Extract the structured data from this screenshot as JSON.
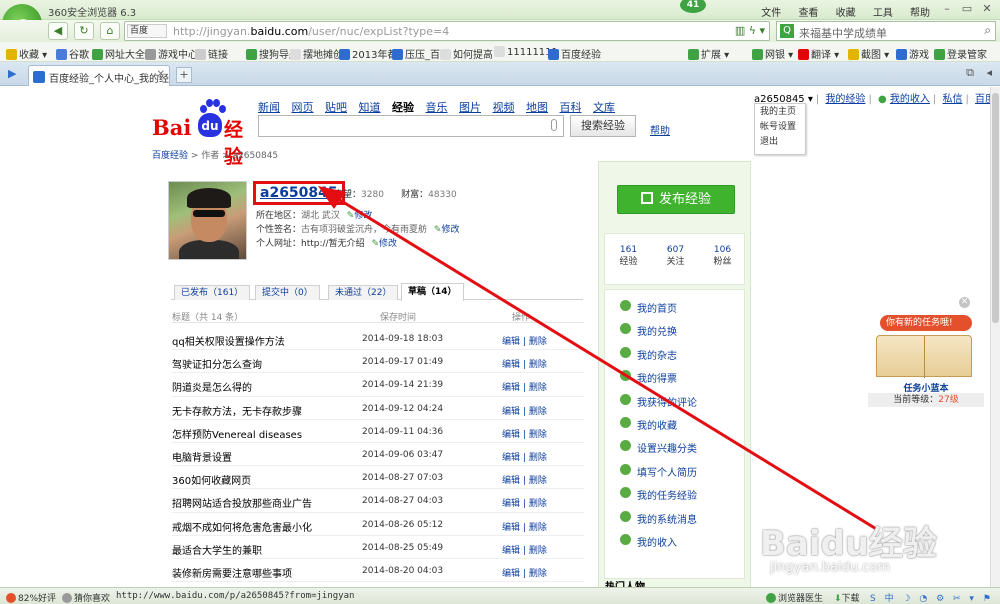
{
  "browser": {
    "title": "360安全浏览器 6.3",
    "menus": [
      "文件",
      "查看",
      "收藏",
      "工具",
      "帮助"
    ],
    "badge": "41",
    "address_prefix": "百度",
    "url_pre": "http://jingyan.",
    "url_host": "baidu.com",
    "url_path": "/user/nuc/expList?type=4",
    "search_placeholder": "来福基中学成绩单",
    "favorites": [
      "收藏",
      "谷歌",
      "网址大全",
      "游戏中心",
      "链接",
      "搜狗导航",
      "摆地摊创",
      "2013年都",
      "压压_百",
      "如何提高",
      "11111111",
      "百度经验"
    ],
    "fav_right": [
      "扩展",
      "网银",
      "翻译",
      "截图",
      "游戏",
      "登录管家"
    ],
    "tab_title": "百度经验_个人中心_我的经验",
    "new_tab": "+"
  },
  "site": {
    "logo": {
      "bai": "Bai",
      "du": "du",
      "jy": "经验"
    },
    "channels": [
      "新闻",
      "网页",
      "贴吧",
      "知道",
      "经验",
      "音乐",
      "图片",
      "视频",
      "地图",
      "百科",
      "文库"
    ],
    "search_button": "搜索经验",
    "help": "帮助",
    "top_user": "a2650845",
    "top_links": [
      "我的经验",
      "我的收入",
      "私信",
      "百度首页"
    ],
    "user_menu": [
      "我的主页",
      "帐号设置",
      "退出"
    ],
    "breadcrumb": [
      "百度经验",
      "作者",
      "a2650845"
    ]
  },
  "profile": {
    "username": "a2650845",
    "reputation_label": "声望：",
    "reputation": "3280",
    "wealth_label": "财富：",
    "wealth": "48330",
    "region_label": "所在地区：",
    "region": "湖北 武汉",
    "sign_label": "个性签名：",
    "sign": "古有项羽破釜沉舟，今有雨夏舫",
    "site_label": "个人网址：",
    "site": "http://暂无介绍",
    "edit": "修改"
  },
  "tabs": [
    {
      "label": "已发布（161）"
    },
    {
      "label": "提交中（0）"
    },
    {
      "label": "未通过（22）"
    },
    {
      "label": "草稿（14）"
    }
  ],
  "table": {
    "h_title": "标题（共 14 条）",
    "h_time": "保存时间",
    "h_op": "操作",
    "edit": "编辑",
    "sep": "|",
    "del": "删除",
    "rows": [
      {
        "title": "qq相关权限设置操作方法",
        "time": "2014-09-18 18:03"
      },
      {
        "title": "驾驶证扣分怎么查询",
        "time": "2014-09-17 01:49"
      },
      {
        "title": "阴道炎是怎么得的",
        "time": "2014-09-14 21:39"
      },
      {
        "title": "无卡存款方法，无卡存款步骤",
        "time": "2014-09-12 04:24"
      },
      {
        "title": "怎样预防Venereal diseases",
        "time": "2014-09-11 04:36"
      },
      {
        "title": "电脑背景设置",
        "time": "2014-09-06 03:47"
      },
      {
        "title": "360如何收藏网页",
        "time": "2014-08-27 07:03"
      },
      {
        "title": "招聘网站适合投放那些商业广告",
        "time": "2014-08-27 04:03"
      },
      {
        "title": "戒烟不成如何将危害危害最小化",
        "time": "2014-08-26 05:12"
      },
      {
        "title": "最适合大学生的兼职",
        "time": "2014-08-25 05:49"
      },
      {
        "title": "装修新房需要注意哪些事项",
        "time": "2014-08-20 04:03"
      }
    ]
  },
  "sidebar": {
    "publish": "发布经验",
    "counts": [
      {
        "num": "161",
        "label": "经验"
      },
      {
        "num": "607",
        "label": "关注"
      },
      {
        "num": "106",
        "label": "粉丝"
      }
    ],
    "links": [
      "我的首页",
      "我的兑换",
      "我的杂志",
      "我的得票",
      "我获得的评论",
      "我的收藏",
      "设置兴趣分类",
      "填写个人简历",
      "我的任务经验",
      "我的系统消息",
      "我的收入"
    ],
    "hot": "热门人物"
  },
  "task": {
    "bubble": "你有新的任务哦!",
    "title": "任务小蓝本",
    "level_label": "当前等级：",
    "level": "27级"
  },
  "watermark": {
    "big": "Baidu经验",
    "small": "jingyan.baidu.com"
  },
  "status": {
    "rating": "82%好评",
    "like": "猜你喜欢",
    "url": "http://www.baidu.com/p/a2650845?from=jingyan",
    "right": [
      "浏览器医生",
      "下载"
    ]
  },
  "colors": {
    "annotation": "#e30d12",
    "link": "#0b3e9c",
    "green": "#3fb22e"
  }
}
